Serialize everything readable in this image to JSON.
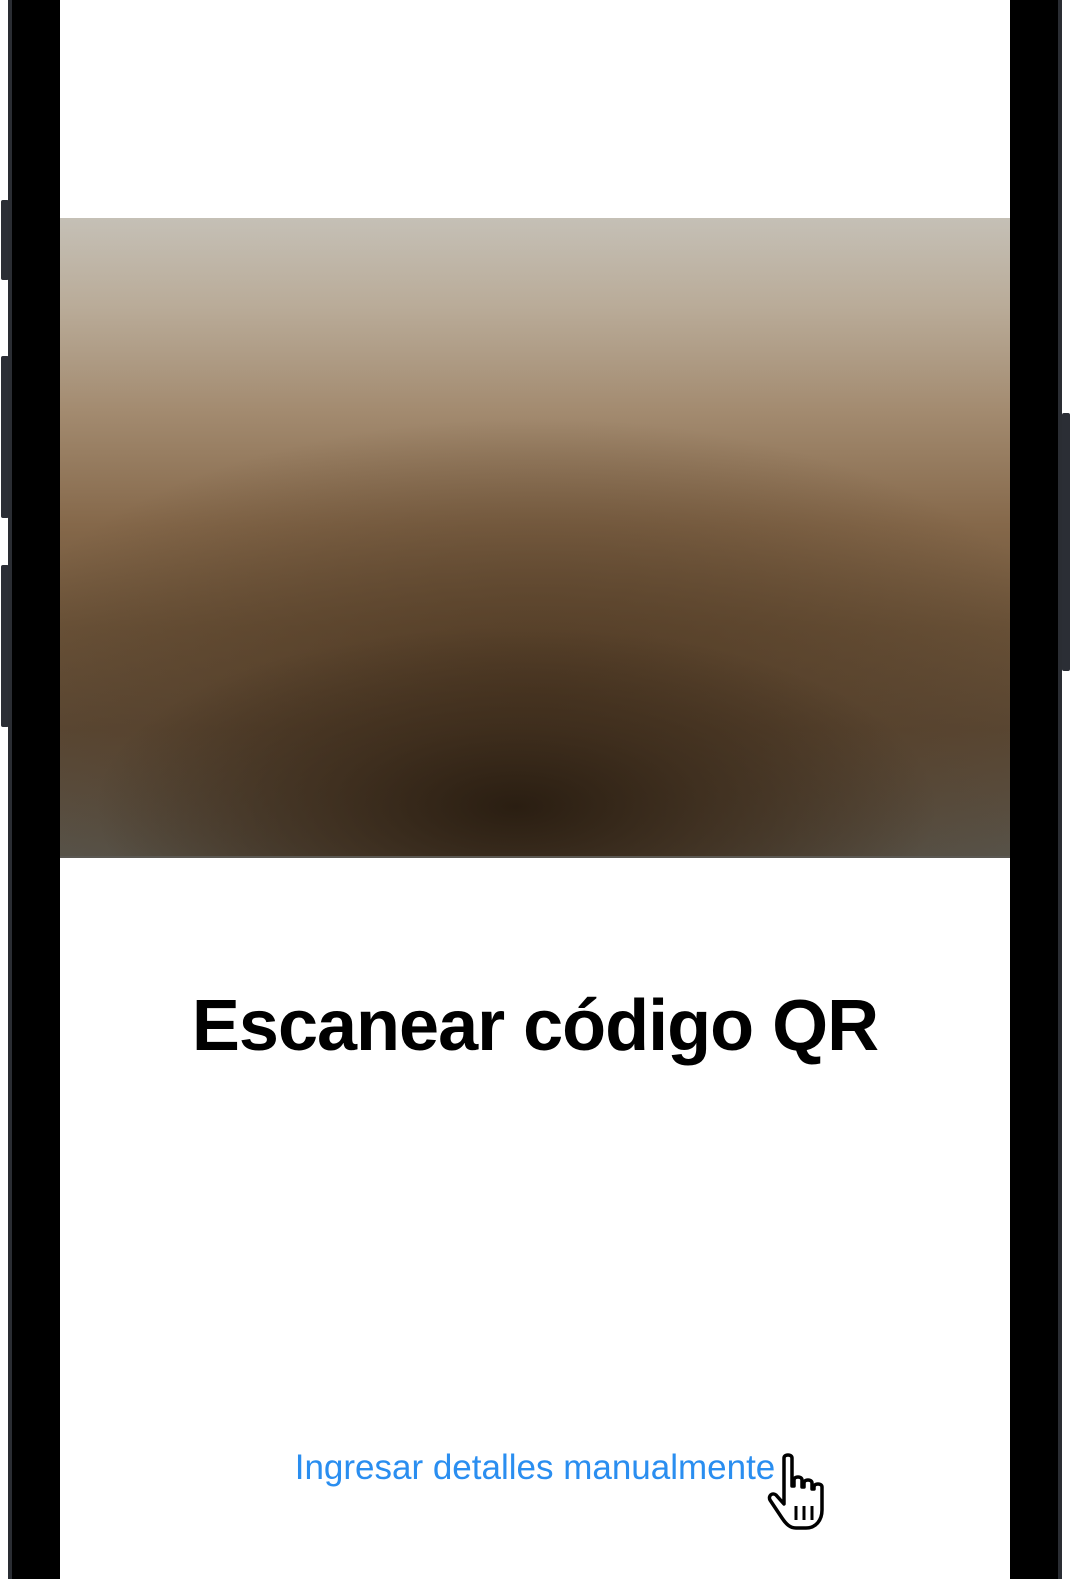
{
  "screen": {
    "title": "Escanear código QR",
    "manual_link_label": "Ingresar detalles manualmente"
  },
  "colors": {
    "link": "#2a8ef0",
    "title": "#000000",
    "bezel": "#000000",
    "background": "#ffffff"
  },
  "icons": {
    "cursor": "hand-pointer-icon"
  }
}
